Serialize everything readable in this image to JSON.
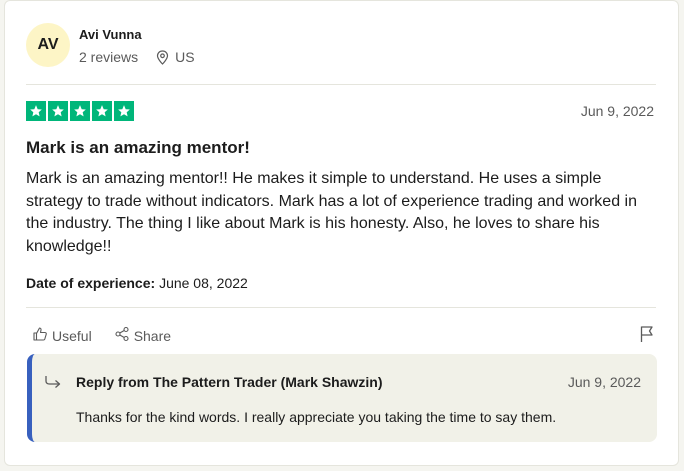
{
  "reviewer": {
    "initials": "AV",
    "name": "Avi Vunna",
    "reviews": "2 reviews",
    "country": "US"
  },
  "review": {
    "rating": 5,
    "max_rating": 5,
    "date": "Jun 9, 2022",
    "title": "Mark is an amazing mentor!",
    "body": "Mark is an amazing mentor!! He makes it simple to understand. He uses a simple strategy to trade without indicators. Mark has a lot of experience trading and worked in the industry. The thing I like about Mark is his honesty. Also, he loves to share his knowledge!!",
    "experience_label": "Date of experience:",
    "experience_date": "June 08, 2022"
  },
  "actions": {
    "useful_label": "Useful",
    "share_label": "Share"
  },
  "reply": {
    "title": "Reply from The Pattern Trader (Mark Shawzin)",
    "date": "Jun 9, 2022",
    "text": "Thanks for the kind words. I really appreciate you taking the time to say them."
  },
  "colors": {
    "star_green": "#00b67a",
    "reply_accent": "#3860be",
    "avatar_bg": "#fdf5c6"
  }
}
